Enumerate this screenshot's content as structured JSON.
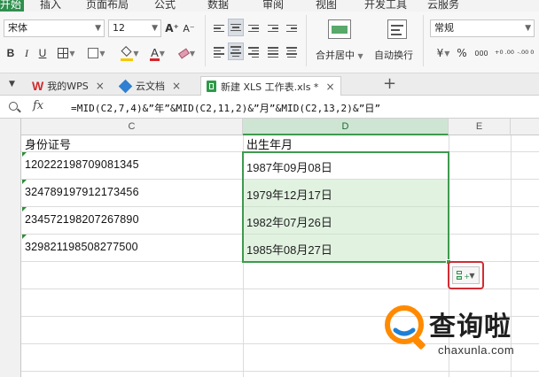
{
  "menubar": {
    "tabs": [
      "开始",
      "插入",
      "页面布局",
      "公式",
      "数据",
      "审阅",
      "视图",
      "开发工具",
      "云服务"
    ],
    "active_color": "#2f8f4e"
  },
  "toolbar": {
    "font_name": "宋体",
    "font_size": "12",
    "bold": "B",
    "italic": "I",
    "underline": "U",
    "font_grow": "A⁺",
    "font_shrink": "A⁻",
    "merge_label": "合并居中",
    "wrap_label": "自动换行",
    "number_format": "常规",
    "currency": "¥",
    "percent": "%",
    "thousands": "000",
    "inc_decimal": "+0 .00",
    "dec_decimal": "-.00 0",
    "text_color": "#d9262b",
    "fill_color": "#f6c700"
  },
  "doctabs": {
    "wps": "我的WPS",
    "cloud": "云文档",
    "active": "新建 XLS 工作表.xls *",
    "close": "×",
    "add": "+"
  },
  "formulabar": {
    "fx": "fx",
    "formula": "=MID(C2,7,4)&”年”&MID(C2,11,2)&”月”&MID(C2,13,2)&”日”"
  },
  "sheet": {
    "columns": [
      "C",
      "D",
      "E"
    ],
    "header_id": "身份证号",
    "header_birth": "出生年月",
    "rows": [
      {
        "id": "120222198709081345",
        "birth": "1987年09月08日"
      },
      {
        "id": "324789197912173456",
        "birth": "1979年12月17日"
      },
      {
        "id": "234572198207267890",
        "birth": "1982年07月26日"
      },
      {
        "id": "329821198508277500",
        "birth": "1985年08月27日"
      }
    ]
  },
  "watermark": {
    "text": "查询啦",
    "sub": "chaxunla.com"
  }
}
